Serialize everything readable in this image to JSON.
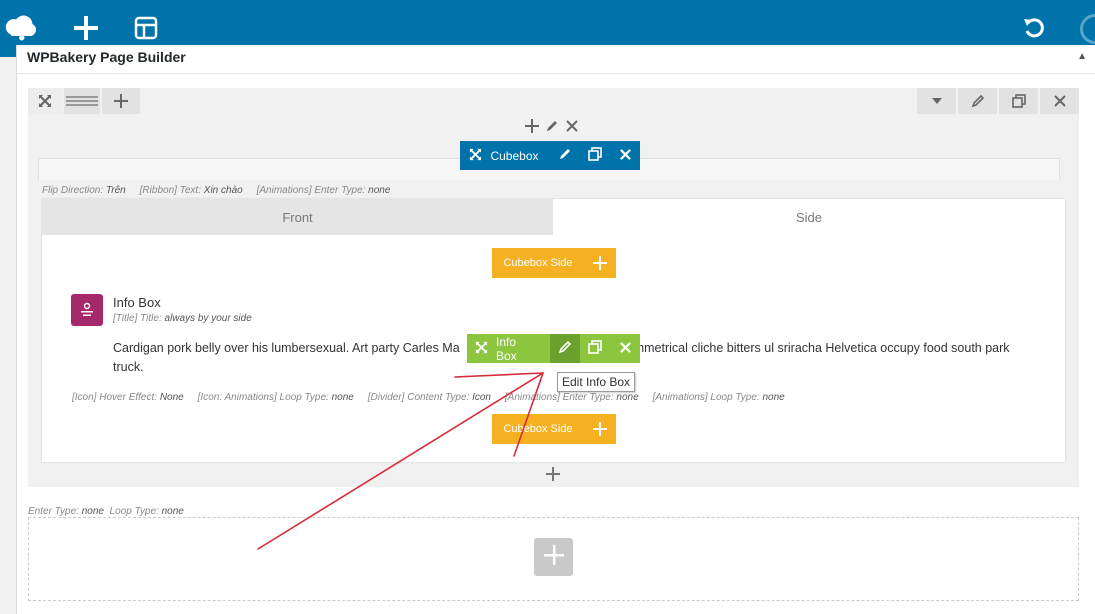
{
  "toolbar": {
    "icons": [
      "cloud-logo-icon",
      "add-icon",
      "templates-icon",
      "undo-icon",
      "search-icon"
    ]
  },
  "panel": {
    "title": "WPBakery Page Builder"
  },
  "cubebox": {
    "label": "Cubebox",
    "params": [
      {
        "key": "Flip Direction:",
        "value": "Trên"
      },
      {
        "key": "[Ribbon] Text:",
        "value": "Xin chào"
      },
      {
        "key": "[Animations] Enter Type:",
        "value": "none"
      }
    ],
    "tabs": [
      "Front",
      "Side"
    ]
  },
  "cubebox_side": {
    "label": "Cubebox Side"
  },
  "infobox": {
    "label": "Info Box",
    "name": "Info Box",
    "title_key": "[Title] Title:",
    "title_value": "always by your side",
    "content": "Cardigan pork belly over his lumbersexual. Art party Carles Ma... ...mmetrical cliche bitters ul sriracha Helvetica occupy food south park truck.",
    "content_left": "Cardigan pork belly over his lumbersexual. Art party Carles Ma",
    "content_right": "mmetrical cliche bitters ul sriracha Helvetica occupy food south park",
    "content_line2": "truck.",
    "params": [
      {
        "key": "[Icon] Hover Effect:",
        "value": "None"
      },
      {
        "key": "[Icon: Animations] Loop Type:",
        "value": "none"
      },
      {
        "key": "[Divider] Content Type:",
        "value": "Icon"
      },
      {
        "key": "[Animations] Enter Type:",
        "value": "none"
      },
      {
        "key": "[Animations] Loop Type:",
        "value": "none"
      }
    ],
    "tooltip": "Edit Info Box"
  },
  "row2": {
    "params": [
      {
        "key": "Enter Type:",
        "value": "none"
      },
      {
        "key": "Loop Type:",
        "value": "none"
      }
    ]
  },
  "colors": {
    "toolbar": "#0073aa",
    "cubebox": "#0073aa",
    "infobox": "#8cc63f",
    "cubebox_side": "#f5b121",
    "info_icon": "#a4286a",
    "annotation_arrow": "#d62b3a"
  }
}
